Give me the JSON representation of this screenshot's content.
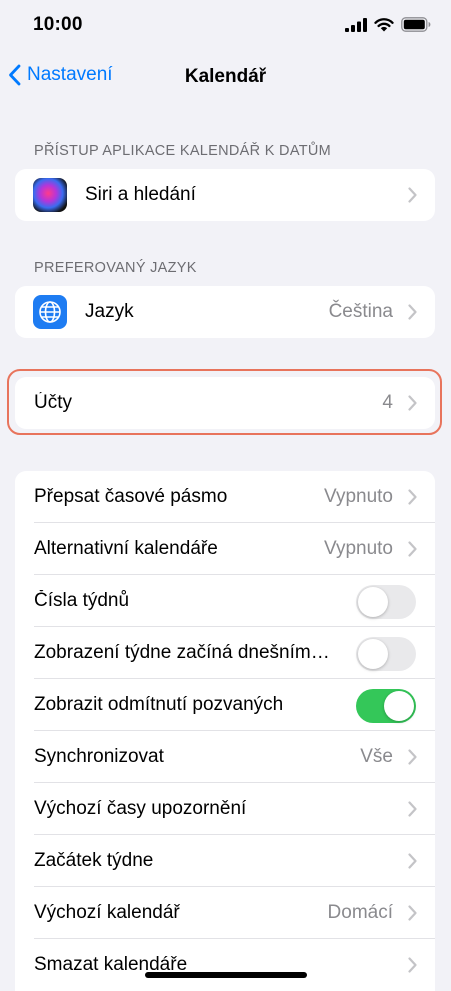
{
  "status_bar": {
    "time": "10:00"
  },
  "nav": {
    "back_label": "Nastavení",
    "title": "Kalendář"
  },
  "sections": {
    "access_header": "PŘÍSTUP APLIKACE KALENDÁŘ K DATŮM",
    "siri_label": "Siri a hledání",
    "language_header": "PREFEROVANÝ JAZYK",
    "language_label": "Jazyk",
    "language_value": "Čeština",
    "accounts_label": "Účty",
    "accounts_value": "4"
  },
  "settings": [
    {
      "label": "Přepsat časové pásmo",
      "value": "Vypnuto",
      "kind": "chevron"
    },
    {
      "label": "Alternativní kalendáře",
      "value": "Vypnuto",
      "kind": "chevron"
    },
    {
      "label": "Čísla týdnů",
      "kind": "toggle",
      "on": false
    },
    {
      "label": "Zobrazení týdne začíná dnešním…",
      "kind": "toggle",
      "on": false
    },
    {
      "label": "Zobrazit odmítnutí pozvaných",
      "kind": "toggle",
      "on": true
    },
    {
      "label": "Synchronizovat",
      "value": "Vše",
      "kind": "chevron"
    },
    {
      "label": "Výchozí časy upozornění",
      "value": "",
      "kind": "chevron"
    },
    {
      "label": "Začátek týdne",
      "value": "",
      "kind": "chevron"
    },
    {
      "label": "Výchozí kalendář",
      "value": "Domácí",
      "kind": "chevron"
    },
    {
      "label": "Smazat kalendáře",
      "value": "",
      "kind": "chevron"
    }
  ],
  "colors": {
    "accent": "#007aff",
    "toggle_on": "#34c759",
    "highlight": "#e8745c"
  }
}
